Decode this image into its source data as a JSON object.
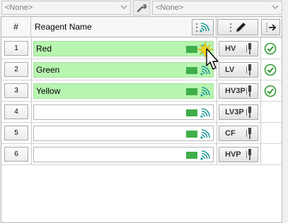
{
  "toolbar": {
    "left_combo_value": "<None>",
    "right_combo_value": "<None>"
  },
  "grid": {
    "columns": {
      "number": "#",
      "name": "Reagent Name"
    },
    "rows": [
      {
        "number": "1",
        "name": "Red",
        "type": "HV",
        "filled": true,
        "checked": true
      },
      {
        "number": "2",
        "name": "Green",
        "type": "LV",
        "filled": true,
        "checked": true
      },
      {
        "number": "3",
        "name": "Yellow",
        "type": "HV3P",
        "filled": true,
        "checked": true
      },
      {
        "number": "4",
        "name": "",
        "type": "LV3P",
        "filled": false,
        "checked": false
      },
      {
        "number": "5",
        "name": "",
        "type": "CF",
        "filled": false,
        "checked": false
      },
      {
        "number": "6",
        "name": "",
        "type": "HVP",
        "filled": false,
        "checked": false
      }
    ]
  },
  "colors": {
    "filled_row": "#b8f5b0",
    "level_bar": "#3fae4a",
    "signal": "#1e9c98",
    "check": "#2f9a2f"
  }
}
